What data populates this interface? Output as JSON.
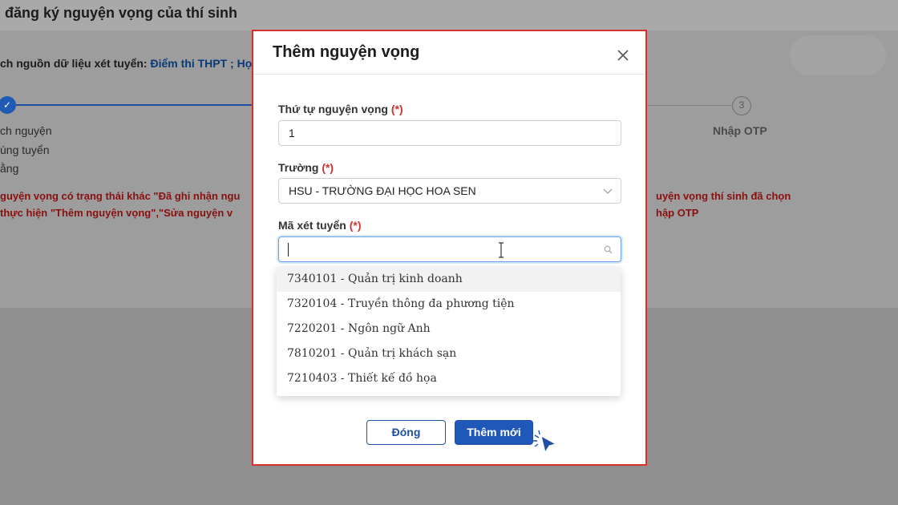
{
  "background": {
    "page_title": "đăng ký nguyện vọng của thí sinh",
    "source_label": "ch nguồn dữ liệu xét tuyển: ",
    "source_value": "Điểm thi THPT ; Học",
    "steps": {
      "step1_check": "✓",
      "step1_lines": [
        "ch nguyện",
        "úng tuyển",
        "ằng"
      ],
      "step3_number": "3",
      "step3_label": "Nhập OTP"
    },
    "warnings": {
      "left_line1": "guyện vọng có trạng thái khác \"Đã ghi nhận ngu",
      "left_line2": "thực hiện \"Thêm nguyện vọng\",\"Sửa nguyện v",
      "right_line1": "uyện vọng thí sinh đã chọn",
      "right_line2": "hập OTP"
    }
  },
  "modal": {
    "title": "Thêm nguyện vọng",
    "required_mark": "(*)",
    "fields": {
      "order": {
        "label": "Thứ tự nguyện vọng",
        "value": "1"
      },
      "school": {
        "label": "Trường",
        "value": "HSU - TRƯỜNG ĐẠI HỌC HOA SEN"
      },
      "code": {
        "label": "Mã xét tuyển",
        "value": ""
      }
    },
    "options": [
      "7340101 - Quản trị kinh doanh",
      "7320104 - Truyền thông đa phương tiện",
      "7220201 - Ngôn ngữ Anh",
      "7810201 - Quản trị khách sạn",
      "7210403 - Thiết kế đồ họa"
    ],
    "buttons": {
      "close": "Đóng",
      "add": "Thêm mới"
    }
  },
  "colors": {
    "primary": "#1f58b8",
    "required": "#d43030",
    "warning": "#8a1010",
    "modal_border": "#d93030"
  }
}
